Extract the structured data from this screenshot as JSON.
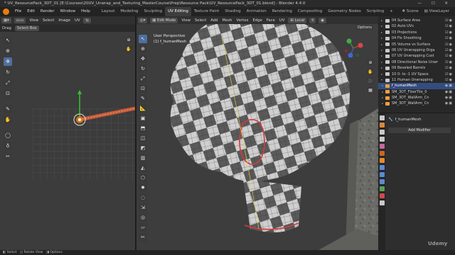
{
  "window": {
    "title": "* UV_ResourcePack_3DT_01 [E:\\Courses\\20UV_Unwrap_and_Texturing_MasterCourse\\Prep\\Resource Pack\\UV_ResourcePack_3DT_01.blend] - Blender 4.4.0"
  },
  "menubar": {
    "items": [
      "File",
      "Edit",
      "Render",
      "Window",
      "Help"
    ],
    "workspaces": [
      "Layout",
      "Modeling",
      "Sculpting",
      "UV Editing",
      "Texture Paint",
      "Shading",
      "Animation",
      "Rendering",
      "Compositing",
      "Geometry Nodes",
      "Scripting"
    ],
    "active_workspace": "UV Editing",
    "scene_label": "Scene",
    "viewlayer_label": "ViewLayer"
  },
  "uv_editor": {
    "header": {
      "mode_label": "Drag",
      "select_box": "Select Box",
      "menus": [
        "View",
        "Select",
        "Image",
        "UV"
      ]
    }
  },
  "viewport": {
    "header": {
      "mode": "Edit Mode",
      "menus": [
        "View",
        "Select",
        "Add",
        "Mesh",
        "Vertex",
        "Edge",
        "Face",
        "UV"
      ],
      "transform_orientation": "Local",
      "options_label": "Options"
    },
    "perspective_label": "User Perspective",
    "object_label": "(1) f_humanMesh"
  },
  "outliner": {
    "rows": [
      {
        "label": "04 Surface Area",
        "selected": false
      },
      {
        "label": "02 Auto UVs",
        "selected": false
      },
      {
        "label": "03 Projections",
        "selected": false
      },
      {
        "label": "04 Fix Shoothing",
        "selected": false
      },
      {
        "label": "05 Volume vs Surface",
        "selected": false
      },
      {
        "label": "06 UV Unwrapping Orga",
        "selected": false
      },
      {
        "label": "07 UV Unwrapping Cust",
        "selected": false
      },
      {
        "label": "08 Directional Noise Unwr",
        "selected": false
      },
      {
        "label": "09 Beveled Barrels",
        "selected": false
      },
      {
        "label": "10 0- to -1 UV Space",
        "selected": false
      },
      {
        "label": "11 Human Unwrapping",
        "selected": false
      },
      {
        "label": "f_humanMesh",
        "selected": true
      },
      {
        "label": "SM_3DT_FloorTile_0",
        "selected": false
      },
      {
        "label": "SM_3DT_WallArm_Cn",
        "selected": false
      },
      {
        "label": "SM_3DT_WallArm_Cn",
        "selected": false
      }
    ]
  },
  "properties": {
    "object_name": "f_humanMesh",
    "add_modifier_label": "Add Modifier"
  },
  "statusbar": {
    "items": [
      "Select",
      "Rotate View",
      "Options"
    ]
  },
  "watermark": "Udemy",
  "colors": {
    "accent": "#4f6fa0",
    "selected_row": "#334d80",
    "brand_orange": "#e87d0d"
  }
}
